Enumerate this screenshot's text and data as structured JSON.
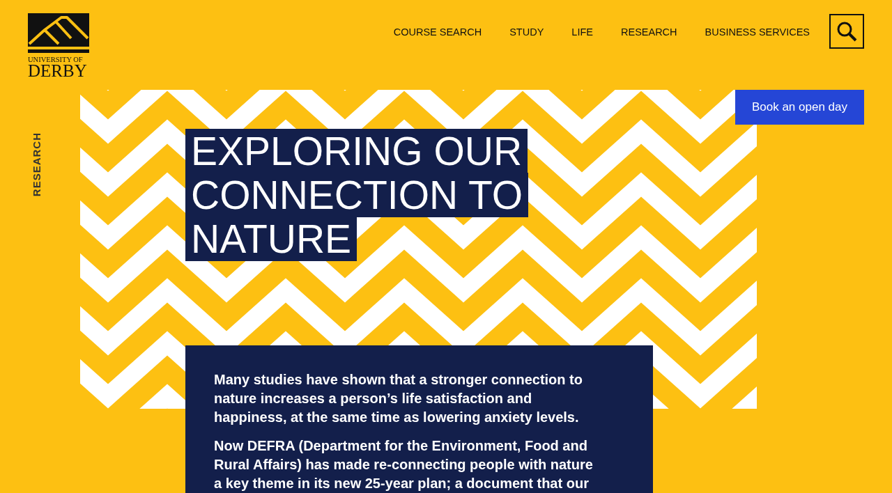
{
  "logo": {
    "lines": [
      "UNIVERSITY OF",
      "DERBY"
    ]
  },
  "nav": [
    "COURSE SEARCH",
    "STUDY",
    "LIFE",
    "RESEARCH",
    "BUSINESS SERVICES"
  ],
  "section_label": "RESEARCH",
  "cta": "Book an open day",
  "title": "EXPLORING OUR CONNECTION TO NATURE",
  "paragraphs": [
    "Many studies have shown that a stronger connection to nature increases a person’s life satisfaction and happiness, at the same time as lowering anxiety levels.",
    "Now DEFRA (Department for the Environment, Food and Rural Affairs) has made re-connecting people with nature a key theme in its new 25-year plan; a document that our"
  ]
}
